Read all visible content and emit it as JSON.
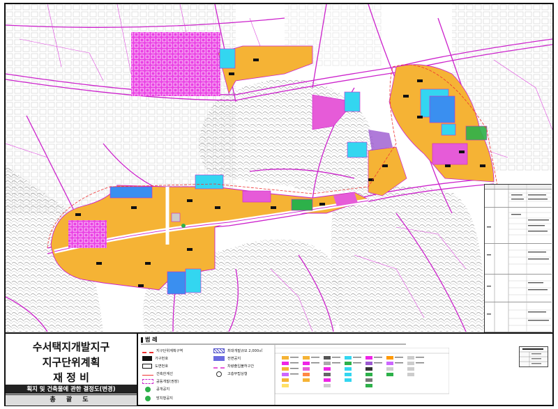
{
  "title_block": {
    "line1": "수서택지개발지구",
    "line2": "지구단위계획",
    "line3": "재 정 비",
    "subtitle": "획지 및 건축물에 관한 결정도(변경)",
    "sheet_name": "총 괄 도"
  },
  "legend": {
    "heading": "범 례",
    "items": [
      {
        "label": "지구단위계획구역",
        "symbol": "red-dash-line-icon"
      },
      {
        "label": "가구번호",
        "symbol": "block-number-icon"
      },
      {
        "label": "도면번호",
        "symbol": "drawing-number-icon"
      },
      {
        "label": "건축한계선",
        "symbol": "build-limit-line-icon"
      },
      {
        "label": "공동개발(권장)",
        "symbol": "joint-dev-icon"
      },
      {
        "label": "공개공지",
        "symbol": "green-circle-icon"
      },
      {
        "label": "방치형공지",
        "symbol": "green-circle-icon"
      },
      {
        "label": "최대개발규모 2,000㎡",
        "symbol": "hatched-area-icon"
      },
      {
        "label": "전면공지",
        "symbol": "blue-fill-icon"
      },
      {
        "label": "차량출입불허구간",
        "symbol": "pink-dash-line-icon"
      },
      {
        "label": "고층부탑상형",
        "symbol": "crosshair-icon"
      }
    ]
  },
  "colors": {
    "residential": "#f5b335",
    "commercial": "#ee24e6",
    "road_lines": "#cc22cc",
    "public": "#33d6f0",
    "public_dark": "#3a8ff0",
    "park": "#2db14a",
    "pink_zone": "#e65bd8",
    "contour": "#8a8a8a"
  }
}
